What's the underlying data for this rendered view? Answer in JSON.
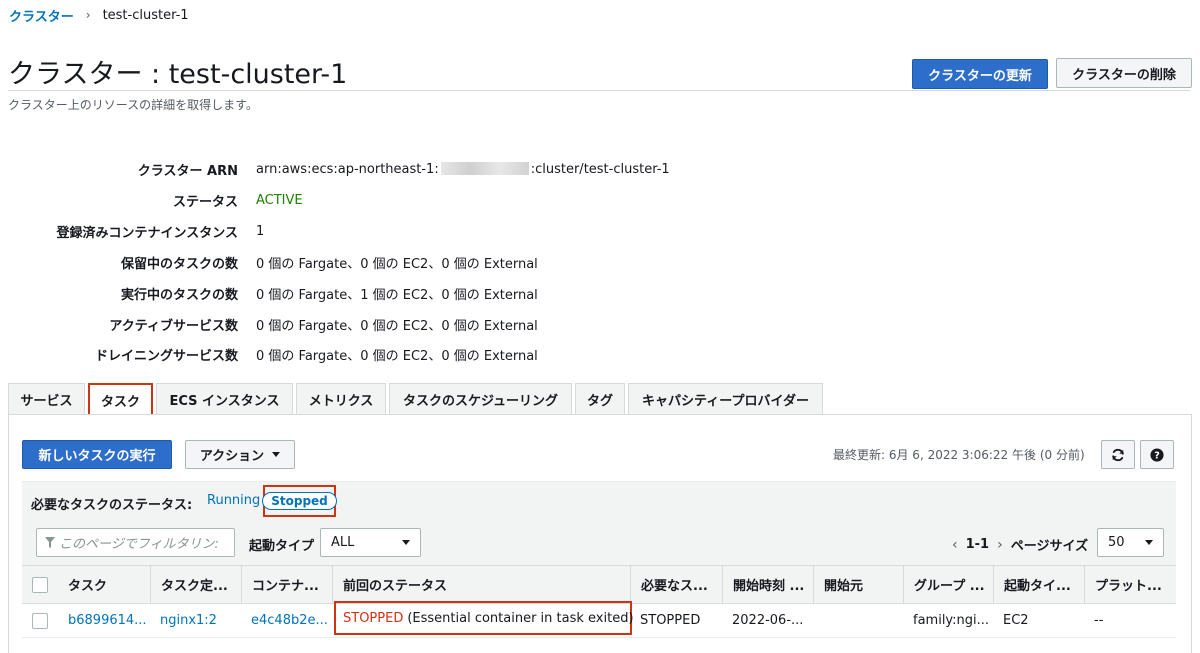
{
  "breadcrumb": {
    "root": "クラスター",
    "current": "test-cluster-1"
  },
  "header": {
    "title": "クラスター : test-cluster-1",
    "subtitle": "クラスター上のリソースの詳細を取得します。",
    "update_label": "クラスターの更新",
    "delete_label": "クラスターの削除"
  },
  "details": {
    "arn_label": "クラスター ARN",
    "arn_prefix": "arn:aws:ecs:ap-northeast-1:",
    "arn_suffix": ":cluster/test-cluster-1",
    "status_label": "ステータス",
    "status_value": "ACTIVE",
    "instances_label": "登録済みコンテナインスタンス",
    "instances_value": "1",
    "pending_label": "保留中のタスクの数",
    "pending_value": "0 個の Fargate、0 個の EC2、0 個の External",
    "running_label": "実行中のタスクの数",
    "running_value": "0 個の Fargate、1 個の EC2、0 個の External",
    "active_services_label": "アクティブサービス数",
    "active_services_value": "0 個の Fargate、0 個の EC2、0 個の External",
    "draining_label": "ドレイニングサービス数",
    "draining_value": "0 個の Fargate、0 個の EC2、0 個の External"
  },
  "tabs": [
    {
      "label": "サービス"
    },
    {
      "label": "タスク"
    },
    {
      "label": "ECS インスタンス"
    },
    {
      "label": "メトリクス"
    },
    {
      "label": "タスクのスケジューリング"
    },
    {
      "label": "タグ"
    },
    {
      "label": "キャパシティープロバイダー"
    }
  ],
  "toolbar": {
    "run_task_label": "新しいタスクの実行",
    "actions_label": "アクション",
    "last_updated": "最終更新: 6月 6, 2022 3:06:22 午後 (0 分前)"
  },
  "desired_status": {
    "label": "必要なタスクのステータス:",
    "running": "Running",
    "stopped": "Stopped"
  },
  "filter": {
    "placeholder": "このページでフィルタリン:",
    "launch_type_label": "起動タイプ",
    "launch_type_value": "ALL",
    "pager_range": "1-1",
    "page_size_label": "ページサイズ",
    "page_size_value": "50"
  },
  "table": {
    "headers": [
      "タスク",
      "タスク定...",
      "コンテナ...",
      "前回のステータス",
      "必要なス...",
      "開始時刻 ...",
      "開始元",
      "グループ ...",
      "起動タイ...",
      "プラット..."
    ],
    "rows": [
      {
        "task": "b6899614...",
        "task_def": "nginx1:2",
        "container": "e4c48b2e...",
        "last_status_code": "STOPPED",
        "last_status_reason": "(Essential container in task exited)",
        "desired_status": "STOPPED",
        "started_at": "2022-06-...",
        "started_by": "",
        "group": "family:ngi...",
        "launch_type": "EC2",
        "platform": "--"
      }
    ]
  },
  "colors": {
    "accent": "#2d6ecb",
    "link": "#0073bb",
    "active": "#1d8102",
    "highlight": "#d13212"
  }
}
